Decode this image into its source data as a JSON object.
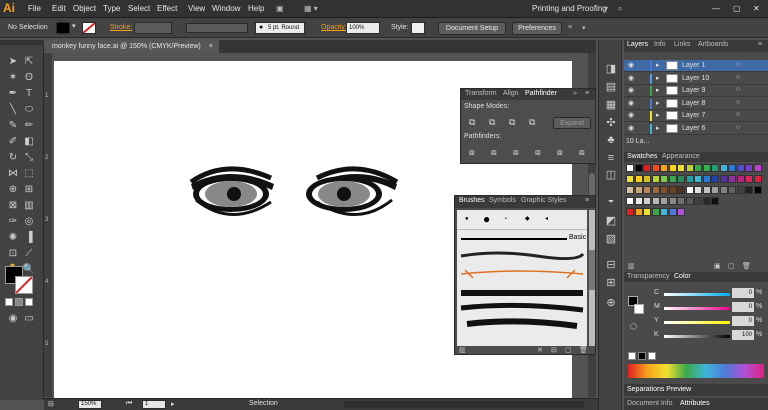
{
  "app": {
    "logo": "Ai",
    "workspace": "Printing and Proofing"
  },
  "menu": [
    "File",
    "Edit",
    "Object",
    "Type",
    "Select",
    "Effect",
    "View",
    "Window",
    "Help"
  ],
  "control": {
    "selection": "No Selection",
    "stroke_label": "Stroke:",
    "brush_size": "5 pt. Round",
    "opacity_label": "Opacity:",
    "opacity_value": "100%",
    "style_label": "Style:",
    "doc_setup": "Document Setup",
    "preferences": "Preferences"
  },
  "document": {
    "tab": "monkey funny face.ai @ 150% (CMYK/Preview)",
    "close": "×"
  },
  "status": {
    "zoom": "150%",
    "page": "1",
    "tool": "Selection"
  },
  "ruler_marks": [
    "1",
    "2",
    "3",
    "4",
    "5"
  ],
  "pathfinder": {
    "tabs": [
      "Transform",
      "Align",
      "Pathfinder"
    ],
    "shape_modes": "Shape Modes:",
    "expand": "Expand",
    "pathfinders": "Pathfinders:"
  },
  "brushes": {
    "tabs": [
      "Brushes",
      "Symbols",
      "Graphic Styles"
    ],
    "basic": "Basic"
  },
  "layers": {
    "tabs": [
      "Layers",
      "Info",
      "Links",
      "Artboards"
    ],
    "items": [
      {
        "name": "Layer 1",
        "color": "#4f7bd8"
      },
      {
        "name": "Layer 10",
        "color": "#4c9ff0"
      },
      {
        "name": "Layer 9",
        "color": "#3aa84a"
      },
      {
        "name": "Layer 8",
        "color": "#4f7bd8"
      },
      {
        "name": "Layer 7",
        "color": "#f2e030"
      },
      {
        "name": "Layer 6",
        "color": "#3fb5d8"
      }
    ],
    "footer": "10 La..."
  },
  "swatches": {
    "tabs": [
      "Swatches",
      "Appearance"
    ]
  },
  "transparency": {
    "tabs": [
      "Transparency",
      "Color"
    ],
    "channels": [
      {
        "label": "C",
        "value": "0"
      },
      {
        "label": "M",
        "value": "0"
      },
      {
        "label": "Y",
        "value": "0"
      },
      {
        "label": "K",
        "value": "100"
      }
    ]
  },
  "separations": {
    "tab": "Separations Preview"
  },
  "bottom_tabs": [
    "Document Info",
    "Attributes"
  ],
  "colors": {
    "accent": "#f7a21b",
    "layer_select": "#3f6aa6"
  }
}
